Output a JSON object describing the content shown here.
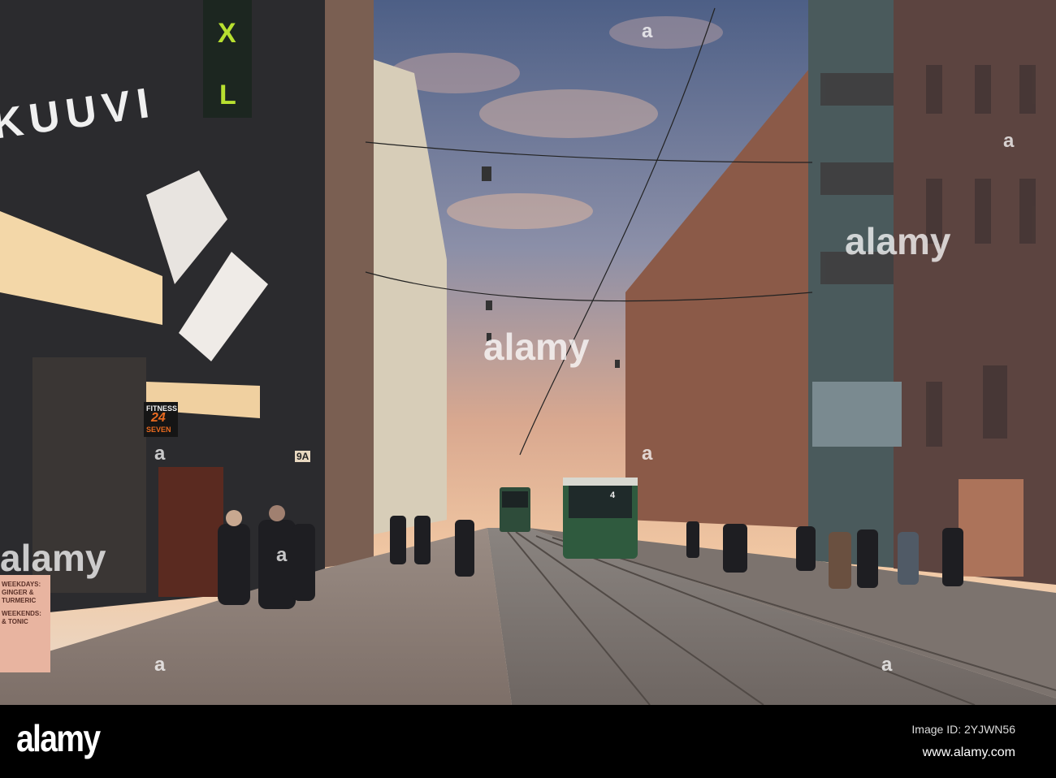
{
  "photo": {
    "signs": {
      "xl_top": "X",
      "xl_bottom": "L",
      "store_name": "KUUVI",
      "gym_line1": "FITNESS",
      "gym_line2": "24",
      "gym_line3": "SEVEN",
      "address": "9A",
      "tram_number": "4",
      "board_line1": "WEEKDAYS:",
      "board_line2": "GINGER &",
      "board_line3": "TURMERIC",
      "board_line4": "WEEKENDS:",
      "board_line5": "& TONIC"
    },
    "watermark": {
      "word": "alamy",
      "letter": "a"
    }
  },
  "footer": {
    "logo": "alamy",
    "image_id": "Image ID: 2YJWN56",
    "website": "www.alamy.com"
  }
}
